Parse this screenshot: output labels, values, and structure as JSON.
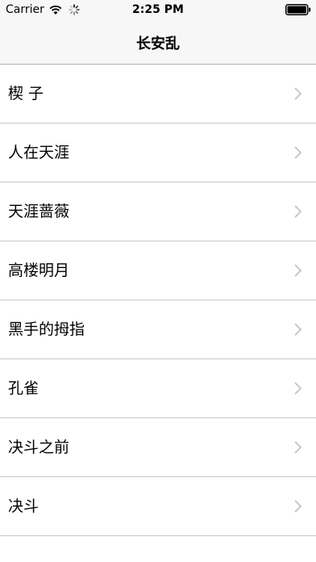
{
  "status_bar": {
    "carrier": "Carrier",
    "time": "2:25 PM",
    "icons": [
      "wifi-icon",
      "activity-spinner-icon",
      "battery-icon"
    ]
  },
  "nav": {
    "title": "长安乱"
  },
  "list": {
    "items": [
      {
        "label": "楔 子"
      },
      {
        "label": "人在天涯"
      },
      {
        "label": "天涯蔷薇"
      },
      {
        "label": "高楼明月"
      },
      {
        "label": "黑手的拇指"
      },
      {
        "label": "孔雀"
      },
      {
        "label": "决斗之前"
      },
      {
        "label": "决斗"
      }
    ],
    "chevron_color": "#c7c7cc",
    "separator_color": "#c8c7cc"
  }
}
